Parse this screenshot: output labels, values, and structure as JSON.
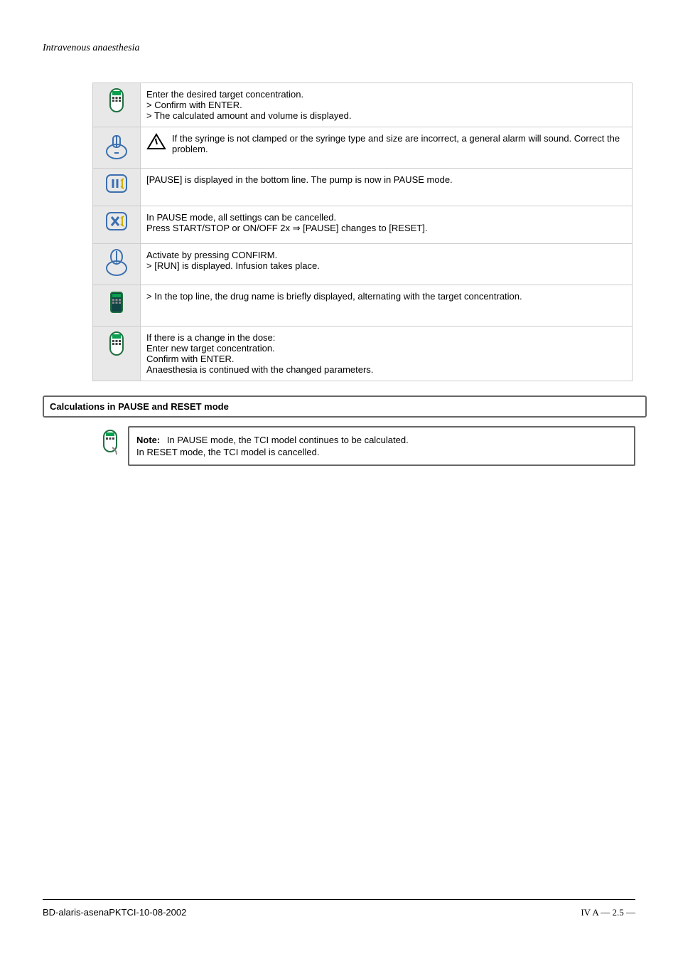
{
  "top_title": "Intravenous anaesthesia",
  "steps": [
    {
      "icon": "remote",
      "lines": [
        "Enter the desired target concentration.",
        "> Confirm with ENTER.",
        "> The calculated amount and volume is displayed."
      ]
    },
    {
      "icon": "hand-warn",
      "warn": true,
      "lines": [
        "If the syringe is not clamped or the syringe type and size are incorrect, a general alarm will sound. Correct the problem."
      ]
    },
    {
      "icon": "pause",
      "lines": [
        "[PAUSE] is displayed in the bottom line. The pump is now in PAUSE mode."
      ]
    },
    {
      "icon": "cancel",
      "lines": [
        "In PAUSE mode, all settings can be cancelled.",
        "Press START/STOP or ON/OFF 2x ⇒ [PAUSE] changes to [RESET]."
      ]
    },
    {
      "icon": "confirm",
      "lines": [
        "Activate by pressing CONFIRM.",
        "> [RUN] is displayed. Infusion takes place."
      ]
    },
    {
      "icon": "remote-dark",
      "lines": [
        "> In the top line, the drug name is briefly displayed, alternating with the target concentration."
      ]
    },
    {
      "icon": "remote",
      "lines": [
        "If there is a change in the dose:",
        "Enter new target concentration.",
        "Confirm with ENTER.",
        "Anaesthesia is continued with the changed parameters."
      ]
    }
  ],
  "calc_title": "Calculations in PAUSE and RESET mode",
  "note": {
    "label": "Note:",
    "line1": "In PAUSE mode, the TCI model continues to be calculated.",
    "line2": "In RESET mode, the TCI model is cancelled."
  },
  "footer_left": "BD-alaris-asenaPKTCI-10-08-2002",
  "footer_right": "IV A  — 2.5 —",
  "alt": {
    "remote": "remote control icon",
    "hand": "hand press icon",
    "warn": "warning triangle icon",
    "pause": "pause icon",
    "cancel": "cancel icon",
    "confirm": "confirm icon",
    "remote_dark": "remote dark icon"
  }
}
